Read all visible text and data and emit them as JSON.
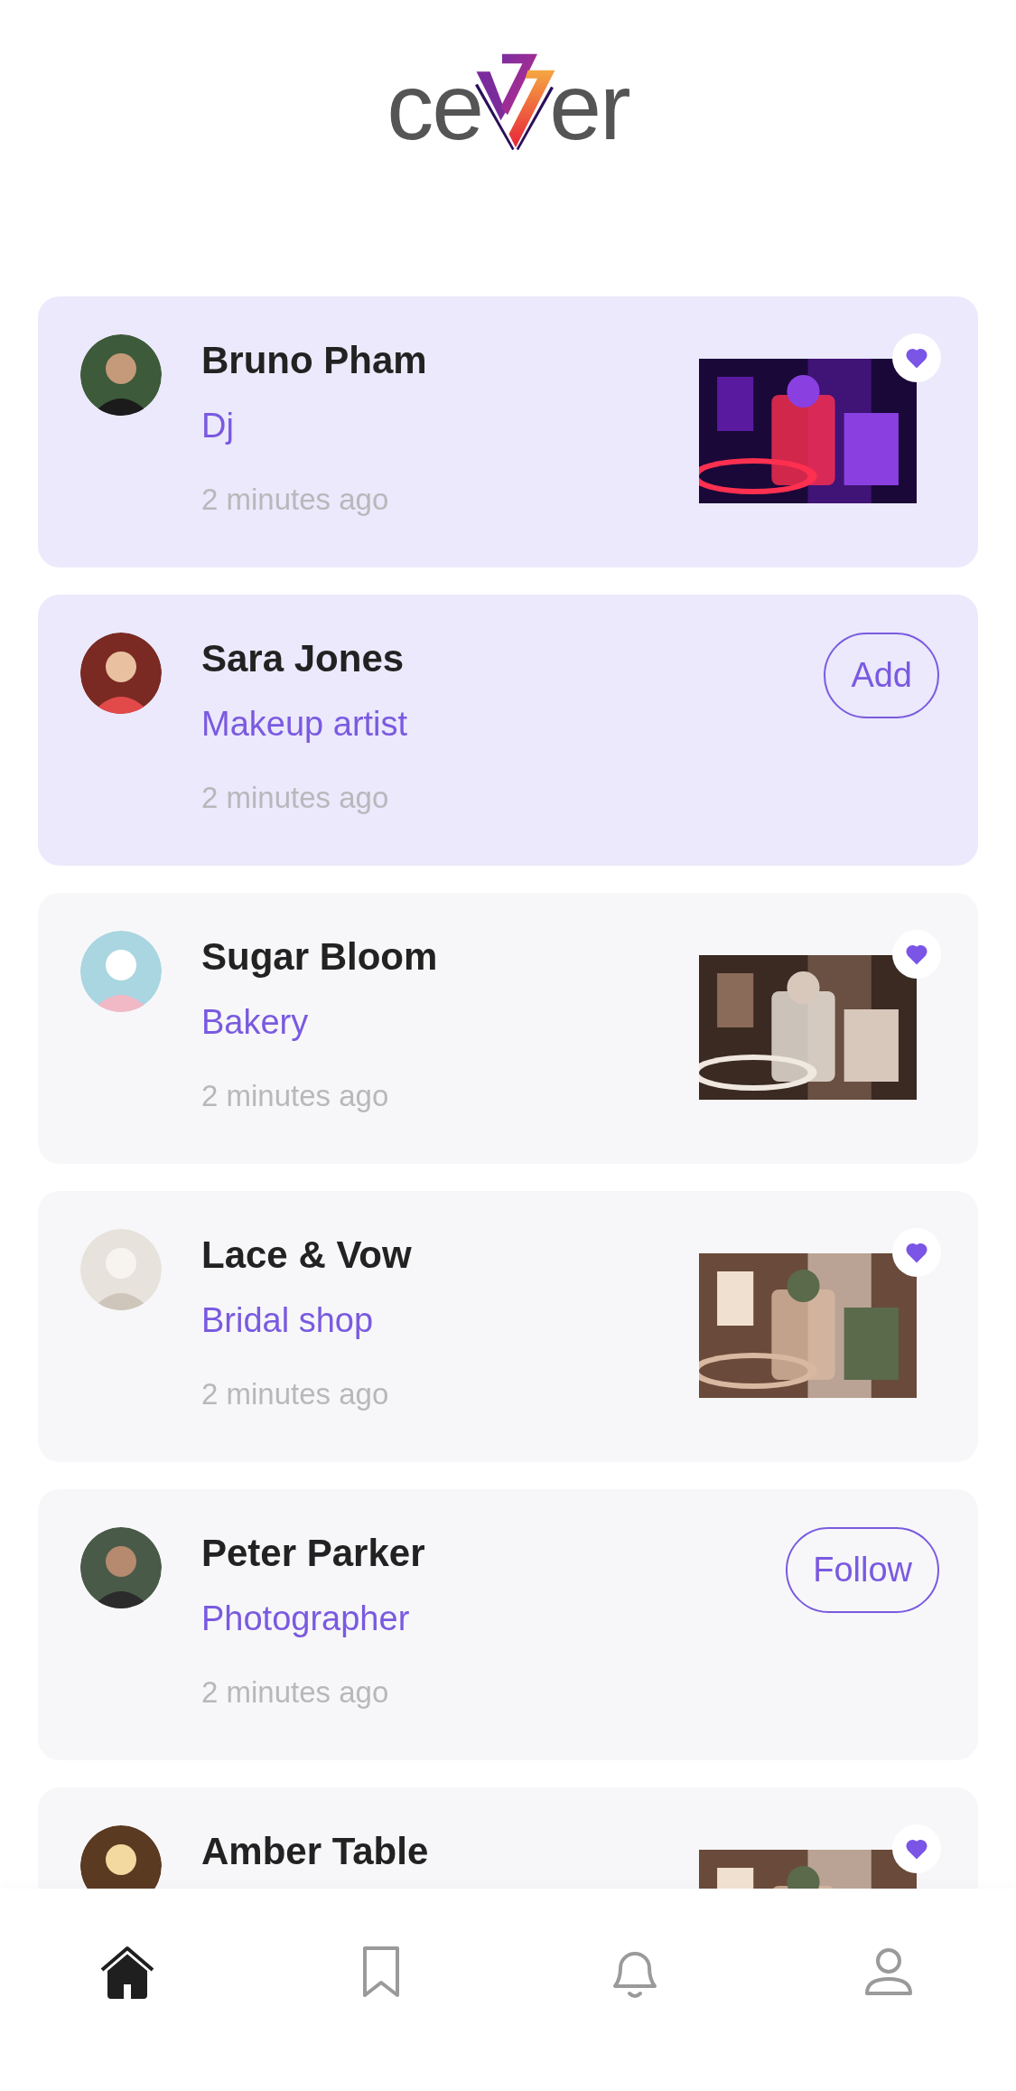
{
  "logo": {
    "left": "ce",
    "right": "er"
  },
  "feed": [
    {
      "name": "Bruno Pham",
      "role": "Dj",
      "time": "2 minutes ago",
      "unread": true,
      "attachment": {
        "kind": "picture",
        "liked": true
      }
    },
    {
      "name": "Sara Jones",
      "role": "Makeup artist",
      "time": "2 minutes ago",
      "unread": true,
      "attachment": {
        "kind": "button",
        "label": "Add"
      }
    },
    {
      "name": "Sugar Bloom",
      "role": "Bakery",
      "time": "2 minutes ago",
      "unread": false,
      "attachment": {
        "kind": "picture",
        "liked": true
      }
    },
    {
      "name": "Lace & Vow",
      "role": "Bridal shop",
      "time": "2 minutes ago",
      "unread": false,
      "attachment": {
        "kind": "picture",
        "liked": true
      }
    },
    {
      "name": "Peter Parker",
      "role": "Photographer",
      "time": "2 minutes ago",
      "unread": false,
      "attachment": {
        "kind": "button",
        "label": "Follow"
      }
    },
    {
      "name": "Amber Table",
      "unread": false,
      "attachment": {
        "kind": "picture",
        "liked": true
      }
    }
  ],
  "nav": [
    {
      "kind": "home",
      "selected": true
    },
    {
      "kind": "bookmark",
      "selected": false
    },
    {
      "kind": "bell",
      "selected": false
    },
    {
      "kind": "profile",
      "selected": false
    }
  ]
}
